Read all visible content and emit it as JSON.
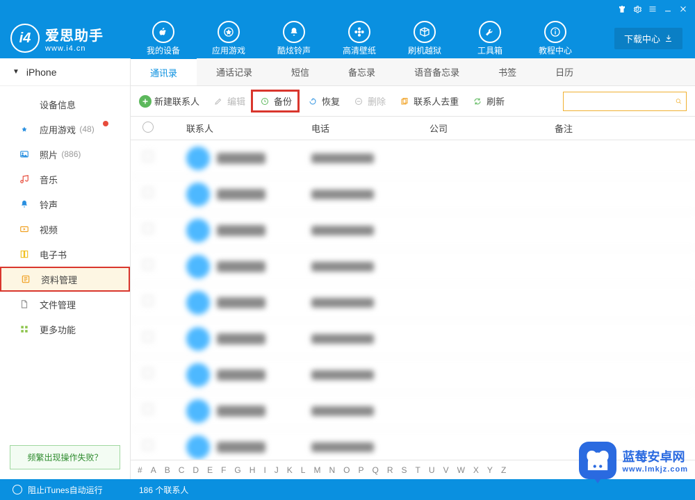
{
  "titlebar_icons": [
    "tshirt",
    "gear",
    "menu",
    "minimize",
    "close"
  ],
  "logo": {
    "title": "爱思助手",
    "sub": "www.i4.cn"
  },
  "top_nav": [
    {
      "label": "我的设备",
      "icon": "apple"
    },
    {
      "label": "应用游戏",
      "icon": "app"
    },
    {
      "label": "酷炫铃声",
      "icon": "bell"
    },
    {
      "label": "高清壁纸",
      "icon": "flower"
    },
    {
      "label": "刷机越狱",
      "icon": "box"
    },
    {
      "label": "工具箱",
      "icon": "wrench"
    },
    {
      "label": "教程中心",
      "icon": "info"
    }
  ],
  "download_btn": "下载中心",
  "device_name": "iPhone",
  "sidebar": [
    {
      "label": "设备信息",
      "icon": "info",
      "color": "#5cb85c"
    },
    {
      "label": "应用游戏",
      "icon": "app",
      "color": "#2a90e0",
      "count": "(48)",
      "dot": true
    },
    {
      "label": "照片",
      "icon": "photo",
      "color": "#2a90e0",
      "count": "(886)"
    },
    {
      "label": "音乐",
      "icon": "music",
      "color": "#e74c3c"
    },
    {
      "label": "铃声",
      "icon": "bell",
      "color": "#2a90e0"
    },
    {
      "label": "视频",
      "icon": "video",
      "color": "#f0a020"
    },
    {
      "label": "电子书",
      "icon": "book",
      "color": "#f0c020"
    },
    {
      "label": "资料管理",
      "icon": "data",
      "color": "#f0a020",
      "selected": true
    },
    {
      "label": "文件管理",
      "icon": "file",
      "color": "#999"
    },
    {
      "label": "更多功能",
      "icon": "more",
      "color": "#8bc34a"
    }
  ],
  "help_link": "频繁出现操作失败？",
  "tabs": [
    "通讯录",
    "通话记录",
    "短信",
    "备忘录",
    "语音备忘录",
    "书签",
    "日历"
  ],
  "active_tab": 0,
  "toolbar": {
    "new": "新建联系人",
    "edit": "编辑",
    "backup": "备份",
    "restore": "恢复",
    "delete": "删除",
    "dedup": "联系人去重",
    "refresh": "刷新"
  },
  "columns": {
    "name": "联系人",
    "phone": "电话",
    "company": "公司",
    "note": "备注"
  },
  "contacts_count": 9,
  "alpha": [
    "#",
    "A",
    "B",
    "C",
    "D",
    "E",
    "F",
    "G",
    "H",
    "I",
    "J",
    "K",
    "L",
    "M",
    "N",
    "O",
    "P",
    "Q",
    "R",
    "S",
    "T",
    "U",
    "V",
    "W",
    "X",
    "Y",
    "Z"
  ],
  "footer": {
    "left": "阻止iTunes自动运行",
    "center": "186 个联系人"
  },
  "watermark": {
    "title": "蓝莓安卓网",
    "sub": "www.lmkjz.com"
  }
}
